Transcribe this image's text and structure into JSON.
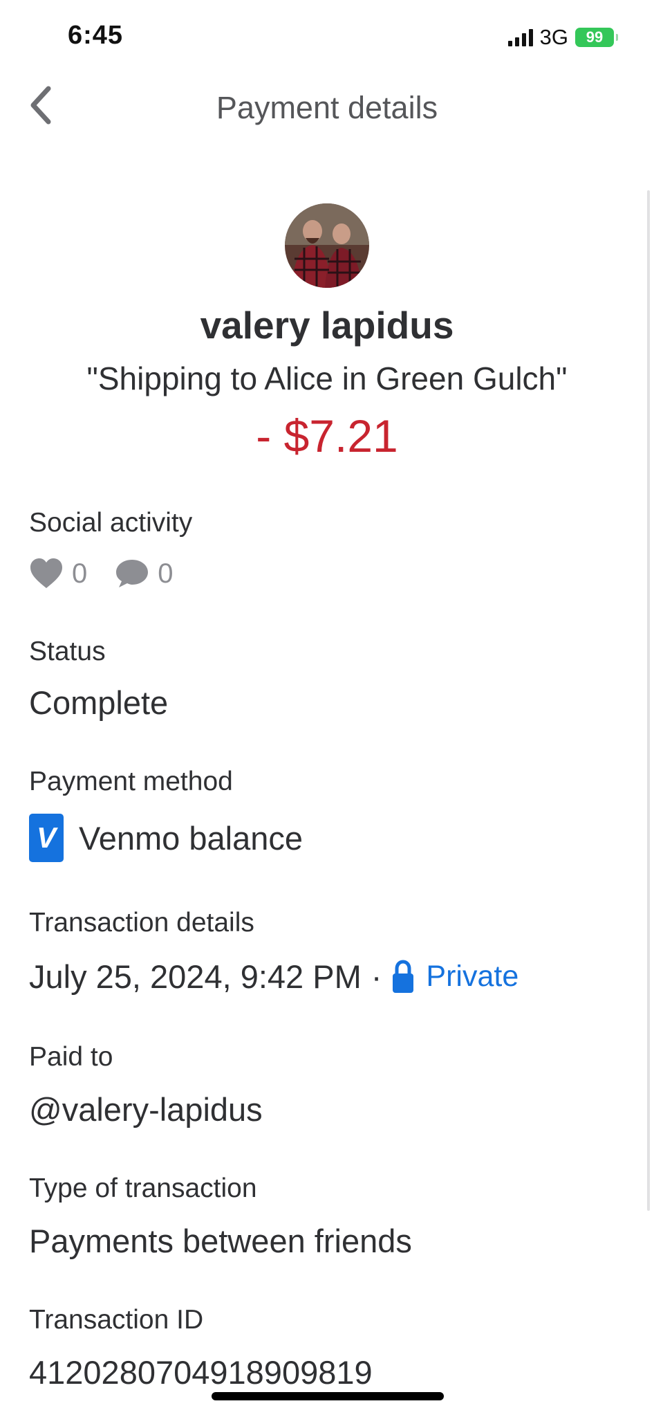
{
  "status_bar": {
    "time": "6:45",
    "network": "3G",
    "battery": "99"
  },
  "header": {
    "title": "Payment details"
  },
  "payee": {
    "name": "valery lapidus",
    "note": "\"Shipping to Alice in Green Gulch\"",
    "amount": "- $7.21"
  },
  "social": {
    "label": "Social activity",
    "likes": "0",
    "comments": "0"
  },
  "status": {
    "label": "Status",
    "value": "Complete"
  },
  "payment_method": {
    "label": "Payment method",
    "logo_letter": "V",
    "value": "Venmo balance"
  },
  "transaction_details": {
    "label": "Transaction details",
    "date": "July 25, 2024, 9:42 PM",
    "separator": "·",
    "privacy": "Private"
  },
  "paid_to": {
    "label": "Paid to",
    "value": "@valery-lapidus"
  },
  "transaction_type": {
    "label": "Type of transaction",
    "value": "Payments between friends"
  },
  "transaction_id": {
    "label": "Transaction ID",
    "value": "4120280704918909819"
  },
  "colors": {
    "amount_red": "#c8242f",
    "venmo_blue": "#1572de",
    "battery_green": "#34c759",
    "muted_icon": "#8d8e93",
    "text": "#2f3033"
  },
  "icons": {
    "back": "chevron-left-icon",
    "like": "heart-icon",
    "comment": "comment-icon",
    "privacy": "lock-icon"
  }
}
